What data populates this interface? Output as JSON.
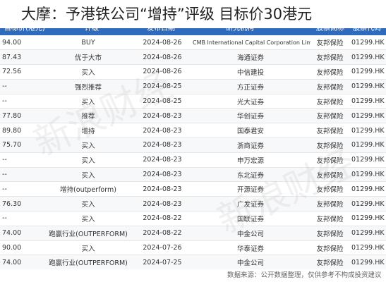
{
  "headline": "大摩：予港铁公司“增持”评级 目标价30港元",
  "table_header": {
    "target": "目标价(港元)",
    "rating": "评级",
    "date": "发布日期",
    "org": "研究机构",
    "name": "股票简称",
    "code": "股票代码"
  },
  "rows": [
    {
      "target": "94.00",
      "rating": "BUY",
      "date": "2024-08-26",
      "org": "CMB International Capital Corporation Limited",
      "name": "友邦保险",
      "code": "01299.HK"
    },
    {
      "target": "87.43",
      "rating": "优于大市",
      "date": "2024-08-26",
      "org": "海通证券",
      "name": "友邦保险",
      "code": "01299.HK"
    },
    {
      "target": "72.56",
      "rating": "买入",
      "date": "2024-08-26",
      "org": "中信建投",
      "name": "友邦保险",
      "code": "01299.HK"
    },
    {
      "target": "--",
      "rating": "强烈推荐",
      "date": "2024-08-25",
      "org": "方正证券",
      "name": "友邦保险",
      "code": "01299.HK"
    },
    {
      "target": "--",
      "rating": "买入",
      "date": "2024-08-25",
      "org": "光大证券",
      "name": "友邦保险",
      "code": "01299.HK"
    },
    {
      "target": "77.80",
      "rating": "推荐",
      "date": "2024-08-23",
      "org": "华创证券",
      "name": "友邦保险",
      "code": "01299.HK"
    },
    {
      "target": "89.80",
      "rating": "增持",
      "date": "2024-08-23",
      "org": "国泰君安",
      "name": "友邦保险",
      "code": "01299.HK"
    },
    {
      "target": "75.70",
      "rating": "买入",
      "date": "2024-08-23",
      "org": "浙商证券",
      "name": "友邦保险",
      "code": "01299.HK"
    },
    {
      "target": "--",
      "rating": "买入",
      "date": "2024-08-23",
      "org": "申万宏源",
      "name": "友邦保险",
      "code": "01299.HK"
    },
    {
      "target": "--",
      "rating": "买入",
      "date": "2024-08-23",
      "org": "东北证券",
      "name": "友邦保险",
      "code": "01299.HK"
    },
    {
      "target": "--",
      "rating": "增持(outperform)",
      "date": "2024-08-23",
      "org": "开源证券",
      "name": "友邦保险",
      "code": "01299.HK"
    },
    {
      "target": "76.30",
      "rating": "买入",
      "date": "2024-08-23",
      "org": "广发证券",
      "name": "友邦保险",
      "code": "01299.HK"
    },
    {
      "target": "--",
      "rating": "买入",
      "date": "2024-08-22",
      "org": "国联证券",
      "name": "友邦保险",
      "code": "01299.HK"
    },
    {
      "target": "74.00",
      "rating": "跑赢行业(OUTPERFORM)",
      "date": "2024-08-22",
      "org": "中金公司",
      "name": "友邦保险",
      "code": "01299.HK"
    },
    {
      "target": "90.00",
      "rating": "买入",
      "date": "2024-07-26",
      "org": "华泰证券",
      "name": "友邦保险",
      "code": "01299.HK"
    },
    {
      "target": "74.00",
      "rating": "跑赢行业(OUTPERFORM)",
      "date": "2024-07-25",
      "org": "中金公司",
      "name": "友邦保险",
      "code": "01299.HK"
    }
  ],
  "footer": "数据来源：公开数据整理，仅供参考不构成投资建议",
  "watermark": "新浪财经",
  "colors": {
    "header_bg": "#2f6bbd",
    "up": "#d9232d",
    "down": "#1f9d4c"
  }
}
